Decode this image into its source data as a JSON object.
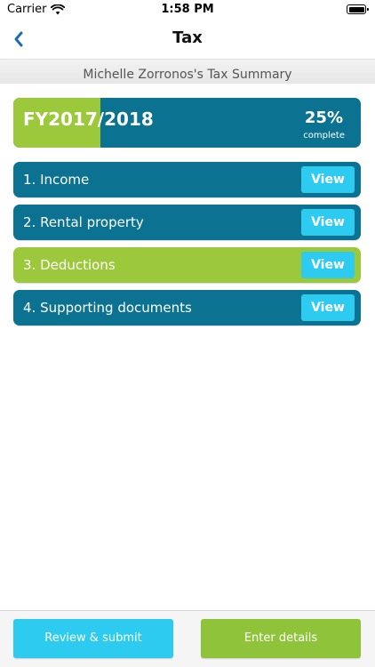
{
  "status_bar": {
    "carrier": "Carrier",
    "time": "1:58 PM"
  },
  "nav": {
    "title": "Tax",
    "back_icon": "chevron-left-icon"
  },
  "summary": {
    "title": "Michelle Zorronos's Tax Summary"
  },
  "progress": {
    "fiscal_year": "FY2017/2018",
    "percent_text": "25%",
    "percent_label": "complete",
    "fraction": 0.25
  },
  "sections": [
    {
      "label": "1. Income",
      "button": "View",
      "active": false
    },
    {
      "label": "2. Rental property",
      "button": "View",
      "active": false
    },
    {
      "label": "3. Deductions",
      "button": "View",
      "active": true
    },
    {
      "label": "4. Supporting documents",
      "button": "View",
      "active": false
    }
  ],
  "actions": {
    "review_submit": "Review & submit",
    "enter_details": "Enter details"
  },
  "colors": {
    "teal": "#0b7391",
    "green": "#9cc93b",
    "cyan": "#2ecbf0",
    "back_arrow": "#1f6fae"
  }
}
